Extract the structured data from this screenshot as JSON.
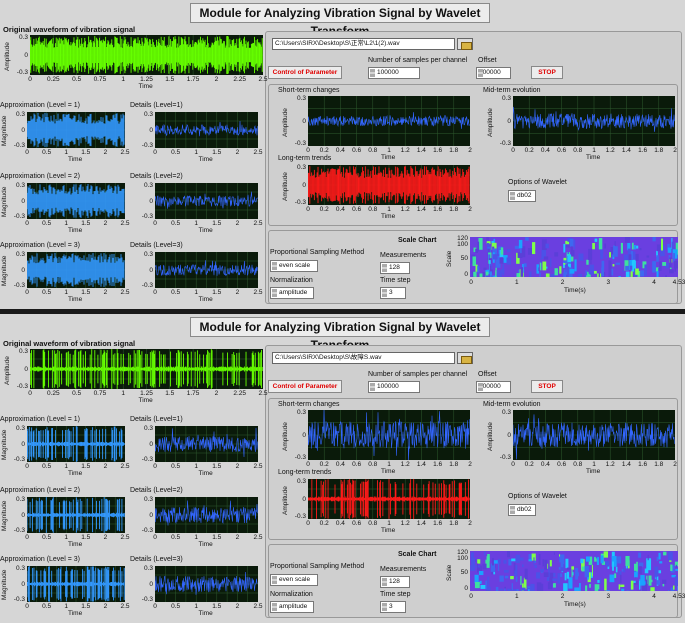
{
  "panels": [
    {
      "title": "Module for Analyzing Vibration Signal by Wavelet Transform",
      "original_label": "Original waveform of vibration signal",
      "file_path": "C:\\Users\\SIRX\\Desktop\\S\\正常\\L2\\1(2).wav",
      "control_button": "Control of Parameter",
      "samples_label": "Number of samples per channel",
      "samples_value": "100000",
      "offset_label": "Offset",
      "offset_value": "100000",
      "stop_button": "STOP",
      "approx1": "Approximation (Level = 1)",
      "approx2": "Approximation (Level = 2)",
      "approx3": "Approximation (Level = 3)",
      "detail1": "Details (Level=1)",
      "detail2": "Details (Level=2)",
      "detail3": "Details (Level=3)",
      "short_term": "Short-term changes",
      "mid_term": "Mid-term evolution",
      "long_term": "Long-term trends",
      "wavelet_label": "Options of Wavelet",
      "wavelet_value": "db02",
      "scale_chart": "Scale Chart",
      "prop_method_label": "Proportional Sampling Method",
      "prop_method_value": "even scale",
      "normalization_label": "Normalization",
      "normalization_value": "amplitude",
      "measurements_label": "Measurements",
      "measurements_value": "128",
      "timestep_label": "Time step",
      "timestep_value": "3",
      "scale_axis": "Scale",
      "time_s": "Time(s)",
      "amplitude": "Amplitude",
      "magnitude": "Magnitude",
      "time": "Time",
      "scale_ticks_y": [
        "120",
        "100",
        "50",
        "0"
      ],
      "scale_ticks_x": [
        "0",
        "1",
        "2",
        "3",
        "4",
        "4.53"
      ],
      "ticks_short": [
        "0",
        "0.2",
        "0.4",
        "0.6",
        "0.8",
        "1",
        "1.2",
        "1.4",
        "1.6",
        "1.8",
        "2"
      ],
      "ticks_orig": [
        "0",
        "0.25",
        "0.5",
        "0.75",
        "1",
        "1.25",
        "1.5",
        "1.75",
        "2",
        "2.25",
        "2.5"
      ],
      "ticks_approx": [
        "0",
        "0.5",
        "1",
        "1.5",
        "2",
        "2.5"
      ],
      "colors": {
        "signal": "#66ff00",
        "approx": "#3399ff",
        "detail": "#3366ff",
        "long": "#ff1a1a",
        "plot_bg": "#0a1a0a"
      }
    },
    {
      "title": "Module for Analyzing Vibration Signal by Wavelet Transform",
      "original_label": "Original waveform of vibration signal",
      "file_path": "C:\\Users\\SIRX\\Desktop\\S\\故障S.wav",
      "control_button": "Control of Parameter",
      "samples_label": "Number of samples per channel",
      "samples_value": "100000",
      "offset_label": "Offset",
      "offset_value": "100000",
      "stop_button": "STOP",
      "approx1": "Approximation (Level = 1)",
      "approx2": "Approximation (Level = 2)",
      "approx3": "Approximation (Level = 3)",
      "detail1": "Details (Level=1)",
      "detail2": "Details (Level=2)",
      "detail3": "Details (Level=3)",
      "short_term": "Short-term changes",
      "mid_term": "Mid-term evolution",
      "long_term": "Long-term trends",
      "wavelet_label": "Options of Wavelet",
      "wavelet_value": "db02",
      "scale_chart": "Scale Chart",
      "prop_method_label": "Proportional Sampling Method",
      "prop_method_value": "even scale",
      "normalization_label": "Normalization",
      "normalization_value": "amplitude",
      "measurements_label": "Measurements",
      "measurements_value": "128",
      "timestep_label": "Time step",
      "timestep_value": "3",
      "scale_axis": "Scale",
      "time_s": "Time(s)",
      "amplitude": "Amplitude",
      "magnitude": "Magnitude",
      "time": "Time",
      "scale_ticks_y": [
        "120",
        "100",
        "50",
        "0"
      ],
      "scale_ticks_x": [
        "0",
        "1",
        "2",
        "3",
        "4",
        "4.53"
      ],
      "ticks_short": [
        "0",
        "0.2",
        "0.4",
        "0.6",
        "0.8",
        "1",
        "1.2",
        "1.4",
        "1.6",
        "1.8",
        "2"
      ],
      "ticks_orig": [
        "0",
        "0.25",
        "0.5",
        "0.75",
        "1",
        "1.25",
        "1.5",
        "1.75",
        "2",
        "2.25",
        "2.5"
      ],
      "ticks_approx": [
        "0",
        "0.5",
        "1",
        "1.5",
        "2",
        "2.5"
      ],
      "colors": {
        "signal": "#66ff00",
        "approx": "#3399ff",
        "detail": "#3366ff",
        "long": "#ff1a1a",
        "plot_bg": "#0a1a0a"
      }
    }
  ]
}
